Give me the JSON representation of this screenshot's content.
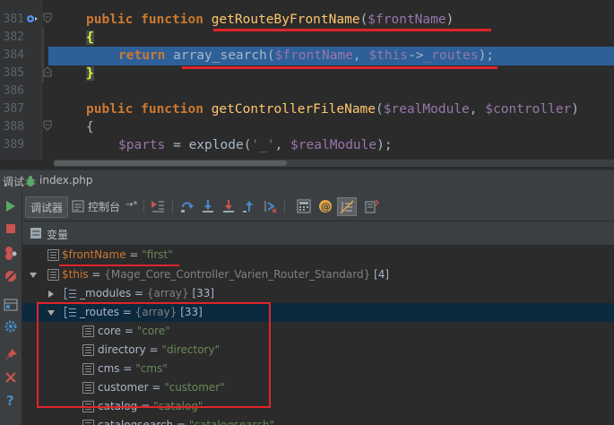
{
  "editor": {
    "lines": [
      {
        "num": "381",
        "tokens": [
          {
            "t": "public ",
            "c": "kw"
          },
          {
            "t": "function ",
            "c": "kw"
          },
          {
            "t": "getRouteByFrontName",
            "c": "fn"
          },
          {
            "t": "(",
            "c": "plain"
          },
          {
            "t": "$frontName",
            "c": "var"
          },
          {
            "t": ")",
            "c": "plain"
          }
        ]
      },
      {
        "num": "382",
        "tokens": [
          {
            "t": "{",
            "c": "brace-hl"
          }
        ]
      },
      {
        "num": "384",
        "tokens": [
          {
            "t": "return ",
            "c": "kw"
          },
          {
            "t": "array_search(",
            "c": "plain"
          },
          {
            "t": "$frontName",
            "c": "var"
          },
          {
            "t": ", ",
            "c": "plain"
          },
          {
            "t": "$this",
            "c": "var"
          },
          {
            "t": "->",
            "c": "plain"
          },
          {
            "t": "_routes",
            "c": "var"
          },
          {
            "t": ");",
            "c": "plain"
          }
        ]
      },
      {
        "num": "385",
        "tokens": [
          {
            "t": "}",
            "c": "brace-hl"
          }
        ]
      },
      {
        "num": "386",
        "tokens": []
      },
      {
        "num": "387",
        "tokens": [
          {
            "t": "public ",
            "c": "kw"
          },
          {
            "t": "function ",
            "c": "kw"
          },
          {
            "t": "getControllerFileName",
            "c": "fn"
          },
          {
            "t": "(",
            "c": "plain"
          },
          {
            "t": "$realModule",
            "c": "var"
          },
          {
            "t": ", ",
            "c": "plain"
          },
          {
            "t": "$controller",
            "c": "var"
          },
          {
            "t": ")",
            "c": "plain"
          }
        ]
      },
      {
        "num": "388",
        "tokens": [
          {
            "t": "{",
            "c": "plain"
          }
        ]
      },
      {
        "num": "389",
        "tokens": [
          {
            "t": "$parts",
            "c": "var"
          },
          {
            "t": " = explode(",
            "c": "plain"
          },
          {
            "t": "'_'",
            "c": "str"
          },
          {
            "t": ", ",
            "c": "plain"
          },
          {
            "t": "$realModule",
            "c": "var"
          },
          {
            "t": ");",
            "c": "plain"
          }
        ]
      }
    ]
  },
  "debug": {
    "title_label": "调试",
    "file_tab": "index.php"
  },
  "toolbar": {
    "tab_debugger": "调试器",
    "tab_console": "控制台",
    "console_arrow": "→*"
  },
  "variables": {
    "header": "变量",
    "front_name": {
      "name": "$frontName",
      "eq": " = ",
      "value": "\"first\""
    },
    "this_row": {
      "name": "$this",
      "eq": " = ",
      "type": "{Mage_Core_Controller_Varien_Router_Standard}",
      "count": "[4]"
    },
    "modules_row": {
      "name": "_modules",
      "eq": " = ",
      "type": "{array}",
      "count": "[33]"
    },
    "routes_row": {
      "name": "_routes",
      "eq": " = ",
      "type": "{array}",
      "count": "[33]"
    },
    "route_items": [
      {
        "name": "core",
        "eq": " = ",
        "value": "\"core\""
      },
      {
        "name": "directory",
        "eq": " = ",
        "value": "\"directory\""
      },
      {
        "name": "cms",
        "eq": " = ",
        "value": "\"cms\""
      },
      {
        "name": "customer",
        "eq": " = ",
        "value": "\"customer\""
      },
      {
        "name": "catalog",
        "eq": " = ",
        "value": "\"catalog\""
      },
      {
        "name": "catalogsearch",
        "eq": " = ",
        "value": "\"catalogsearch\""
      }
    ]
  },
  "colors": {
    "background": "#2b2b2b",
    "execution_line": "#2d6099",
    "annotation_red": "#e0242a",
    "keyword": "#cc7832",
    "function": "#ffc66d",
    "variable": "#9876aa",
    "string": "#6a8759"
  }
}
